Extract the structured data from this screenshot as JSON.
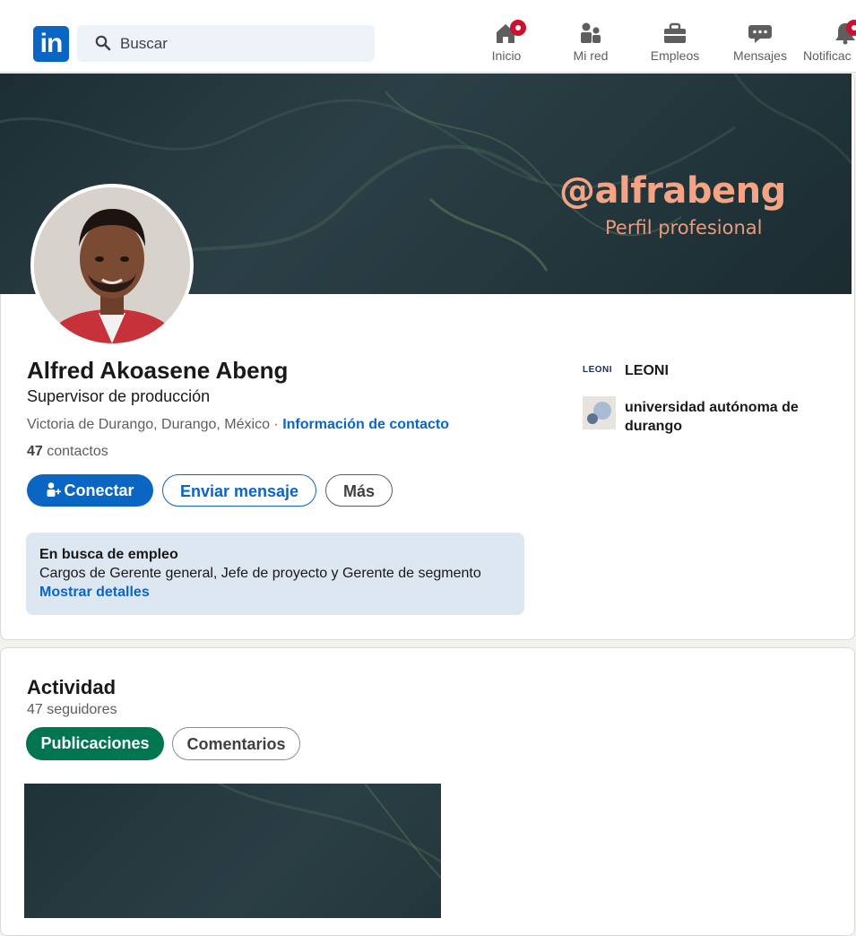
{
  "nav": {
    "logo_text": "in",
    "search_placeholder": "Buscar",
    "items": [
      {
        "label": "Inicio",
        "icon": "home-icon",
        "badge": true
      },
      {
        "label": "Mi red",
        "icon": "people-icon",
        "badge": false
      },
      {
        "label": "Empleos",
        "icon": "briefcase-icon",
        "badge": false
      },
      {
        "label": "Mensajes",
        "icon": "chat-icon",
        "badge": false
      },
      {
        "label": "Notificac",
        "icon": "bell-icon",
        "badge": true
      }
    ]
  },
  "banner": {
    "handle": "@alfrabeng",
    "subtitle": "Perfil profesional"
  },
  "profile": {
    "name": "Alfred Akoasene Abeng",
    "headline": "Supervisor de producción",
    "location": "Victoria de Durango, Durango, México",
    "separator": " · ",
    "contact_link": "Información de contacto",
    "connections_count": "47",
    "connections_label": " contactos",
    "buttons": {
      "connect": "Conectar",
      "message": "Enviar mensaje",
      "more": "Más"
    },
    "open_to_work": {
      "title": "En busca de empleo",
      "roles": "Cargos de Gerente general, Jefe de proyecto y Gerente de segmento",
      "details_link": "Mostrar detalles"
    },
    "experience": [
      {
        "logo_text": "LEONI",
        "name": "LEONI"
      },
      {
        "name_line1": "universidad autónoma de",
        "name_line2": "durango"
      }
    ]
  },
  "activity": {
    "title": "Actividad",
    "followers": "47 seguidores",
    "tabs": [
      "Publicaciones",
      "Comentarios"
    ]
  },
  "colors": {
    "brand": "#0a66c2",
    "active_tab": "#01754f",
    "banner_text": "#f4a484",
    "badge": "#cb112d"
  }
}
